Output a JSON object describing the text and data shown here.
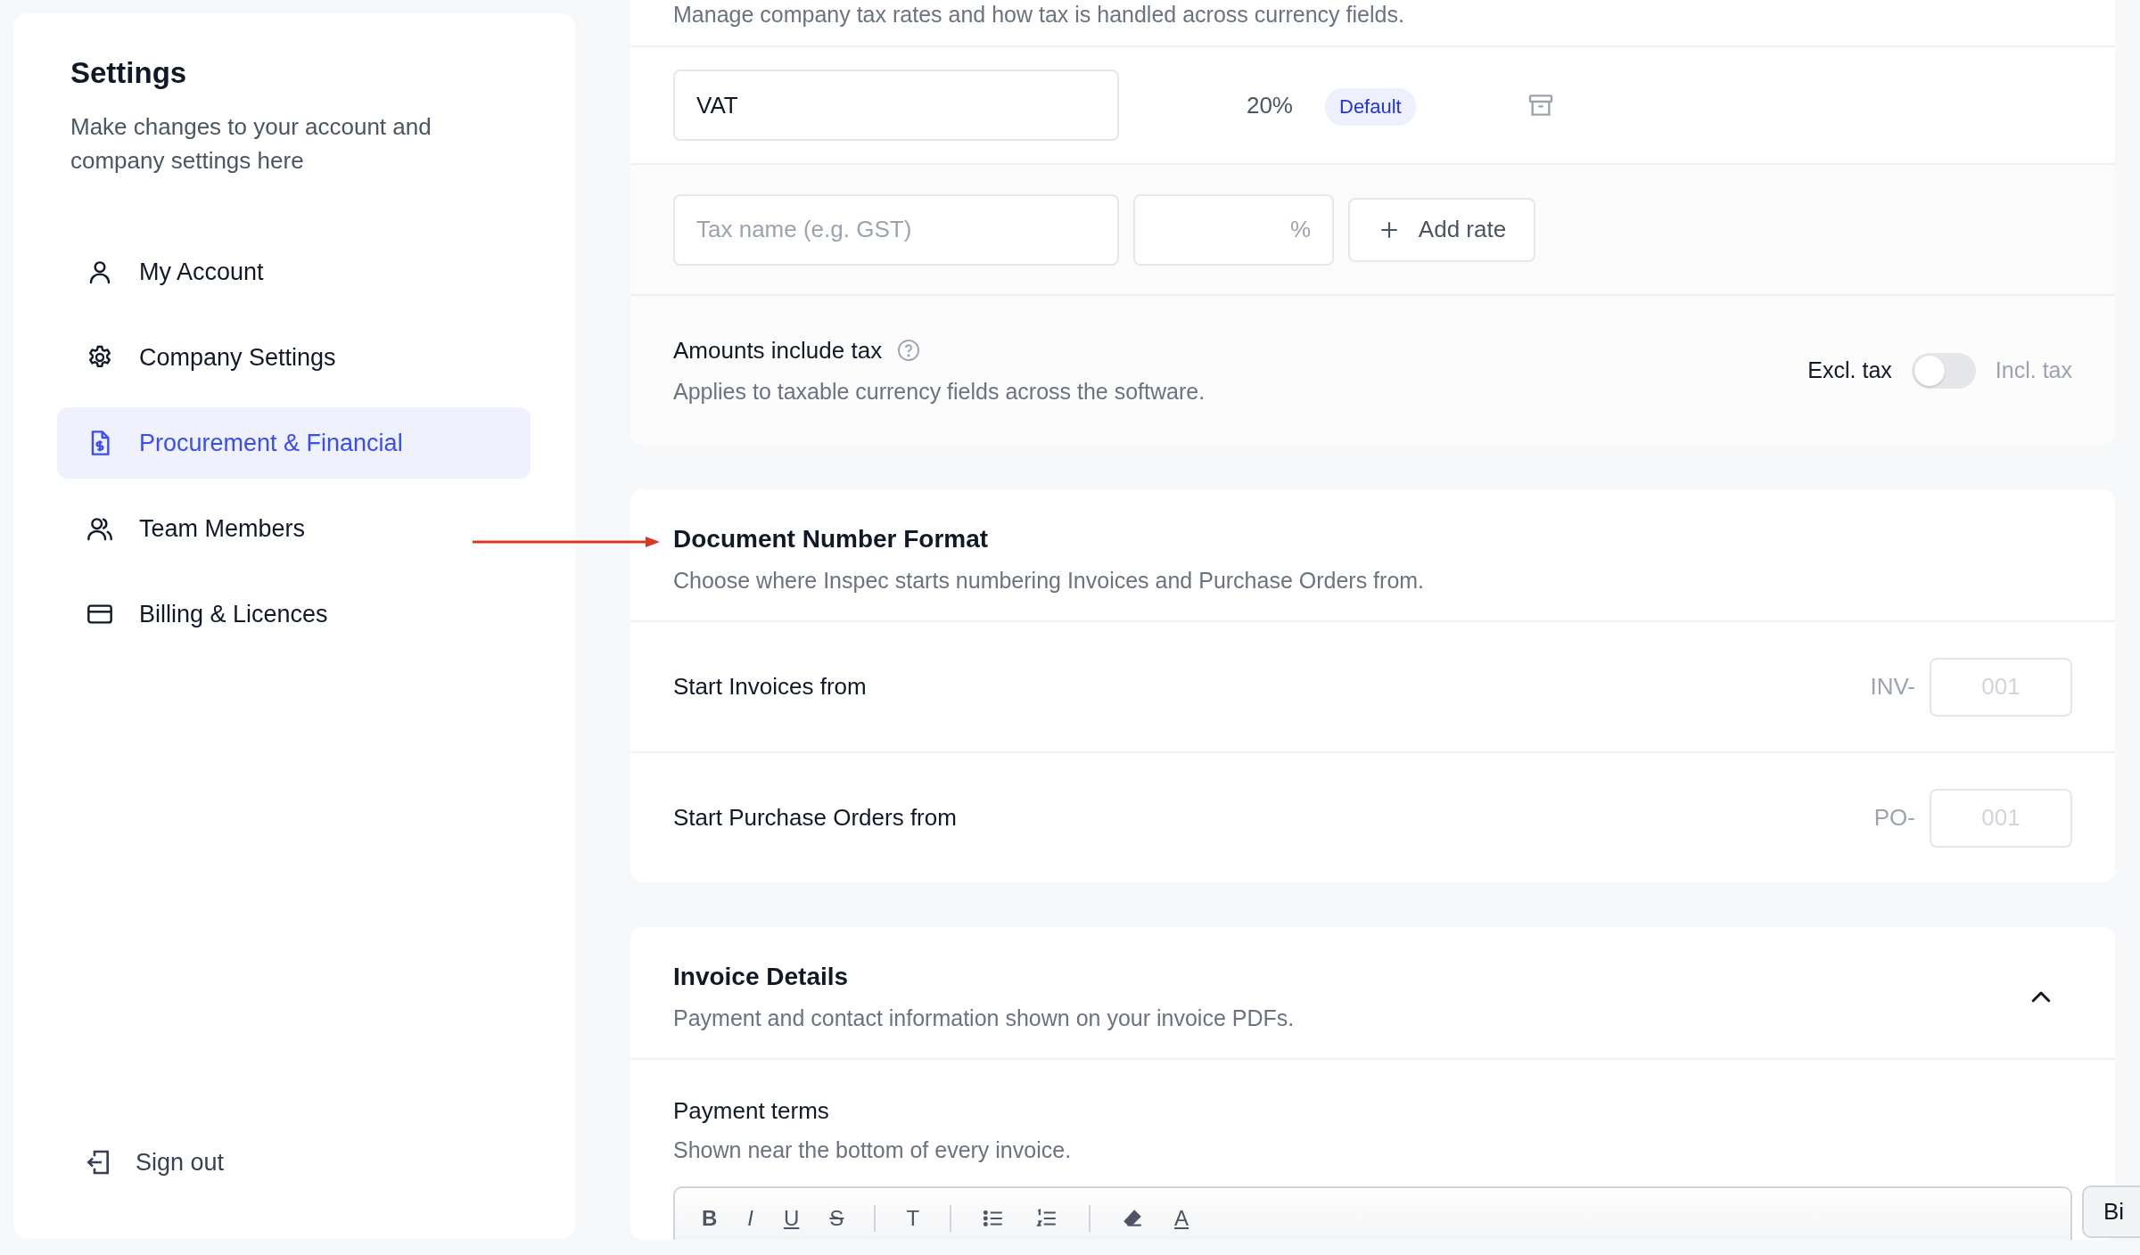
{
  "sidebar": {
    "title": "Settings",
    "subtitle": "Make changes to your account and company settings here",
    "items": [
      {
        "label": "My Account",
        "selected": false
      },
      {
        "label": "Company Settings",
        "selected": false
      },
      {
        "label": "Procurement & Financial",
        "selected": true
      },
      {
        "label": "Team Members",
        "selected": false
      },
      {
        "label": "Billing & Licences",
        "selected": false
      }
    ],
    "sign_out": "Sign out"
  },
  "tax_section": {
    "description": "Manage company tax rates and how tax is handled across currency fields.",
    "rates": [
      {
        "name": "VAT",
        "rate": "20%",
        "badge": "Default"
      }
    ],
    "new_rate": {
      "placeholder": "Tax name (e.g. GST)",
      "percent_suffix": "%",
      "button": "Add rate"
    },
    "amounts_include_tax": {
      "label": "Amounts include tax",
      "description": "Applies to taxable currency fields across the software.",
      "off_label": "Excl. tax",
      "on_label": "Incl. tax",
      "on": false
    }
  },
  "document_number_format": {
    "title": "Document Number Format",
    "description": "Choose where Inspec starts numbering Invoices and Purchase Orders from.",
    "rows": [
      {
        "label": "Start Invoices from",
        "prefix": "INV-",
        "placeholder": "001"
      },
      {
        "label": "Start Purchase Orders from",
        "prefix": "PO-",
        "placeholder": "001"
      }
    ]
  },
  "invoice_details": {
    "title": "Invoice Details",
    "description": "Payment and contact information shown on your invoice PDFs.",
    "expanded": true,
    "payment_terms": {
      "label": "Payment terms",
      "description": "Shown near the bottom of every invoice.",
      "toolbar": [
        [
          {
            "kind": "bold",
            "label": "B"
          },
          {
            "kind": "italic",
            "label": "I"
          },
          {
            "kind": "underline",
            "label": "U"
          },
          {
            "kind": "strike",
            "label": "S"
          }
        ],
        [
          {
            "kind": "heading",
            "label": "T"
          }
        ],
        [
          {
            "kind": "bullets"
          },
          {
            "kind": "numbers"
          }
        ],
        [
          {
            "kind": "eraser"
          },
          {
            "kind": "color",
            "label": "A"
          }
        ]
      ]
    }
  },
  "tooltip": "Bi"
}
